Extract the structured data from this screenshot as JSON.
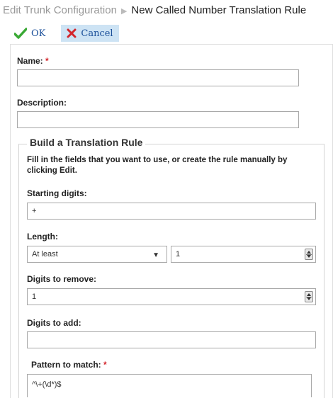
{
  "breadcrumb": {
    "parent": "Edit Trunk Configuration",
    "separator": "▶",
    "current": "New Called Number Translation Rule"
  },
  "toolbar": {
    "ok_label": "OK",
    "cancel_label": "Cancel"
  },
  "form": {
    "name_label": "Name:",
    "name_required": "*",
    "name_value": "",
    "description_label": "Description:",
    "description_value": ""
  },
  "rule": {
    "legend": "Build a Translation Rule",
    "instructions": "Fill in the fields that you want to use, or create the rule manually by clicking Edit.",
    "starting_digits_label": "Starting digits:",
    "starting_digits_value": "+",
    "length_label": "Length:",
    "length_mode": "At least",
    "length_value": "1",
    "digits_remove_label": "Digits to remove:",
    "digits_remove_value": "1",
    "digits_add_label": "Digits to add:",
    "digits_add_value": "",
    "pattern_label": "Pattern to match:",
    "pattern_required": "*",
    "pattern_value": "^\\+(\\d*)$"
  },
  "colors": {
    "accent": "#1a4f99",
    "required": "#d3252b",
    "ok_icon": "#3aa935",
    "cancel_icon": "#d3252b",
    "cancel_bg": "#cde3f4"
  },
  "icons": {
    "ok": "checkmark-icon",
    "cancel": "x-icon",
    "crumb": "triangle-right-icon",
    "dropdown": "caret-down-icon",
    "spinner": "spinner-icon"
  }
}
